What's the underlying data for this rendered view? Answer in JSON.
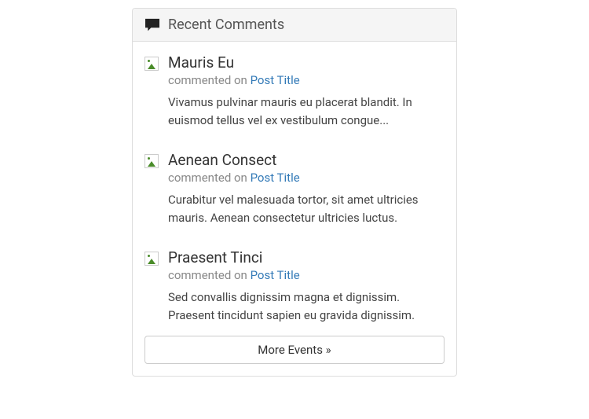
{
  "panel": {
    "title": "Recent Comments"
  },
  "comments": [
    {
      "author": "Mauris Eu",
      "meta_prefix": "commented on ",
      "post_link": "Post Title",
      "body": "Vivamus pulvinar mauris eu placerat blandit. In euismod tellus vel ex vestibulum congue..."
    },
    {
      "author": "Aenean Consect",
      "meta_prefix": "commented on ",
      "post_link": "Post Title",
      "body": "Curabitur vel malesuada tortor, sit amet ultricies mauris. Aenean consectetur ultricies luctus."
    },
    {
      "author": "Praesent Tinci",
      "meta_prefix": "commented on ",
      "post_link": "Post Title",
      "body": "Sed convallis dignissim magna et dignissim. Praesent tincidunt sapien eu gravida dignissim."
    }
  ],
  "footer": {
    "more_label": "More Events »"
  }
}
